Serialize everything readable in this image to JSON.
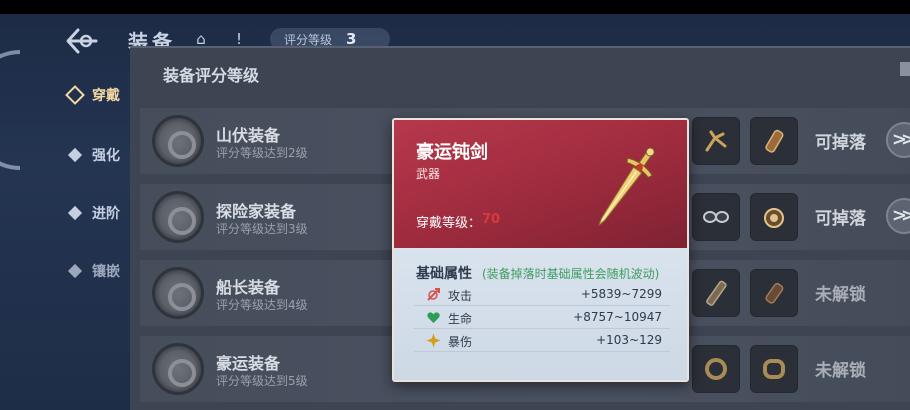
{
  "header": {
    "title": "装备",
    "score_label": "评分等级",
    "score_value": "3"
  },
  "side_menu": [
    {
      "label": "穿戴",
      "active": true
    },
    {
      "label": "强化",
      "active": false
    },
    {
      "label": "进阶",
      "active": false
    },
    {
      "label": "镶嵌",
      "active": false
    }
  ],
  "panel": {
    "title": "装备评分等级",
    "rows": [
      {
        "name": "山伏装备",
        "requirement": "评分等级达到2级",
        "status": "可掉落",
        "has_go": true,
        "slot_icons": [
          "claw-icon",
          "bracer-icon"
        ]
      },
      {
        "name": "探险家装备",
        "requirement": "评分等级达到3级",
        "status": "可掉落",
        "has_go": true,
        "slot_icons": [
          "goggles-icon",
          "amulet-icon"
        ]
      },
      {
        "name": "船长装备",
        "requirement": "评分等级达到4级",
        "status": "未解锁",
        "has_go": false,
        "slot_icons": [
          "spyglass-icon",
          "gauntlet-icon"
        ]
      },
      {
        "name": "豪运装备",
        "requirement": "评分等级达到5级",
        "status": "未解锁",
        "has_go": false,
        "slot_icons": [
          "ring-icon",
          "bangle-icon"
        ]
      }
    ],
    "go_label": ">>"
  },
  "tooltip": {
    "item_name": "豪运钝剑",
    "item_type": "武器",
    "level_label": "穿戴等级：",
    "level_value": "70",
    "attr_title": "基础属性",
    "attr_note": "(装备掉落时基础属性会随机波动)",
    "attributes": [
      {
        "name": "攻击",
        "value": "+5839~7299",
        "icon": "attack-icon",
        "color": "#d9534f"
      },
      {
        "name": "生命",
        "value": "+8757~10947",
        "icon": "heart-icon",
        "color": "#2e9e55"
      },
      {
        "name": "暴伤",
        "value": "+103~129",
        "icon": "crit-icon",
        "color": "#d4a017"
      }
    ]
  },
  "colors": {
    "accent_gold": "#f2d9a3",
    "tooltip_red": "#a32d40",
    "level_red": "#d83a3a",
    "note_green": "#3e9d5e"
  }
}
